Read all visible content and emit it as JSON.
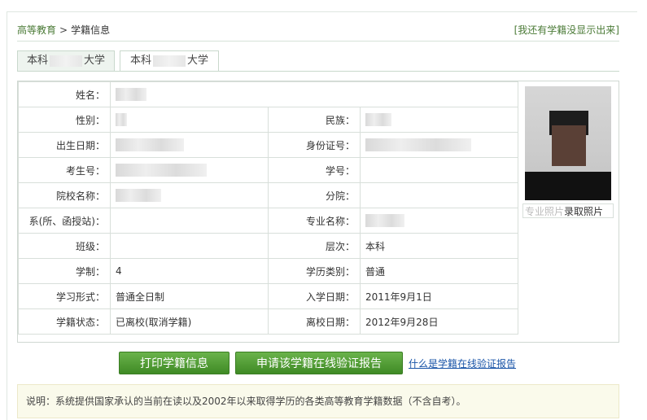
{
  "breadcrumb": {
    "home": "高等教育",
    "sep": ">",
    "current": "学籍信息"
  },
  "missing_link": "[我还有学籍没显示出来]",
  "tabs": [
    {
      "prefix": "本科",
      "suffix": "大学",
      "active": false
    },
    {
      "prefix": "本科",
      "suffix": "大学",
      "active": true
    }
  ],
  "fields": {
    "name_label": "姓名：",
    "gender_label": "性别：",
    "ethnicity_label": "民族：",
    "birth_label": "出生日期：",
    "id_label": "身份证号：",
    "exam_no_label": "考生号：",
    "student_no_label": "学号：",
    "school_label": "院校名称：",
    "branch_label": "分院：",
    "dept_label": "系(所、函授站)：",
    "major_label": "专业名称：",
    "class_label": "班级：",
    "level_label": "层次：",
    "level_value": "本科",
    "duration_label": "学制：",
    "duration_value": "4",
    "category_label": "学历类别：",
    "category_value": "普通",
    "mode_label": "学习形式：",
    "mode_value": "普通全日制",
    "enroll_label": "入学日期：",
    "enroll_value": "2011年9月1日",
    "status_label": "学籍状态：",
    "status_value": "已离校(取消学籍)",
    "leave_label": "离校日期：",
    "leave_value": "2012年9月28日"
  },
  "photo": {
    "caption_faded": "专业照片",
    "caption": "录取照片"
  },
  "buttons": {
    "print": "打印学籍信息",
    "verify": "申请该学籍在线验证报告"
  },
  "what_link": "什么是学籍在线验证报告",
  "note": "说明：系统提供国家承认的当前在读以及2002年以来取得学历的各类高等教育学籍数据（不含自考）。",
  "colors": {
    "accent_green": "#4a9a2e",
    "link_blue": "#1a55a8"
  }
}
